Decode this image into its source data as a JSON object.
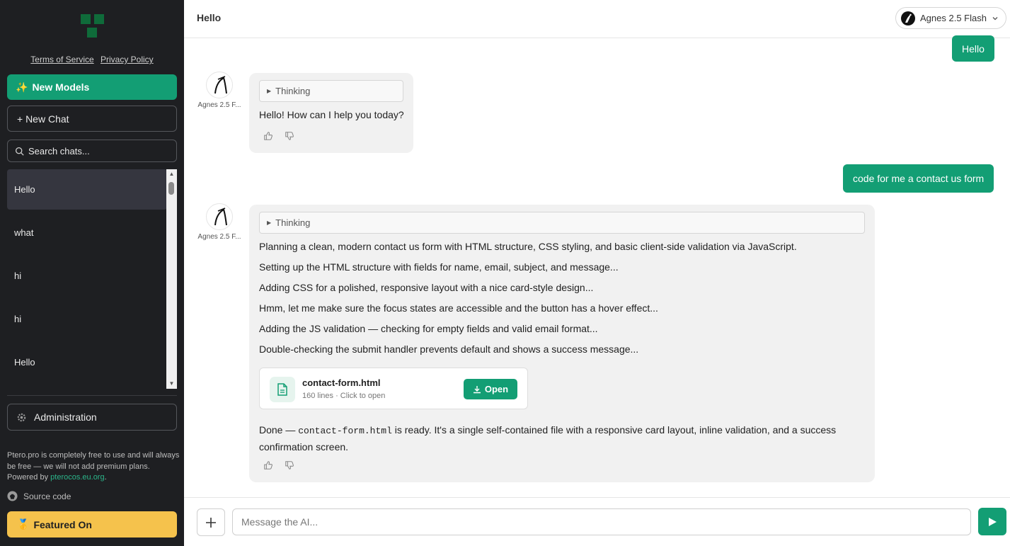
{
  "sidebar": {
    "terms_label": "Terms of Service",
    "privacy_label": "Privacy Policy",
    "new_models_icon": "✨",
    "new_models_label": "New Models",
    "new_chat_label": "+ New Chat",
    "search_placeholder": "Search chats...",
    "chats": [
      "Hello",
      "what",
      "hi",
      "hi",
      "Hello"
    ],
    "admin_label": "Administration",
    "footer_text": "Ptero.pro is completely free to use and will always be free — we will not add premium plans. Powered by ",
    "footer_link": "pterocos.eu.org",
    "footer_end": ".",
    "source_code_label": "Source code",
    "featured_icon": "🥇",
    "featured_label": "Featured On"
  },
  "header": {
    "title": "Hello",
    "model_name": "Agnes 2.5 Flash"
  },
  "conversation": {
    "user_msg_1": "Hello",
    "ai_name": "Agnes 2.5 F...",
    "thinking_label": "Thinking",
    "ai_msg_1": "Hello! How can I help you today?",
    "user_msg_2": "code for me a contact us form",
    "ai_thoughts": [
      "Planning a clean, modern contact us form with HTML structure, CSS styling, and basic client-side validation via JavaScript.",
      "Setting up the HTML structure with fields for name, email, subject, and message...",
      "Adding CSS for a polished, responsive layout with a nice card-style design...",
      "Hmm, let me make sure the focus states are accessible and the button has a hover effect...",
      "Adding the JS validation — checking for empty fields and valid email format...",
      "Double-checking the submit handler prevents default and shows a success message..."
    ],
    "file_name": "contact-form.html",
    "file_meta": "160 lines · Click to open",
    "open_label": "Open",
    "done_prefix": "Done — ",
    "done_code": "contact-form.html",
    "done_suffix": " is ready. It's a single self-contained file with a responsive card layout, inline validation, and a success confirmation screen."
  },
  "composer": {
    "placeholder": "Message the AI..."
  },
  "colors": {
    "accent": "#139e74",
    "sidebar_bg": "#1e1f22",
    "featured": "#f5c24c"
  }
}
